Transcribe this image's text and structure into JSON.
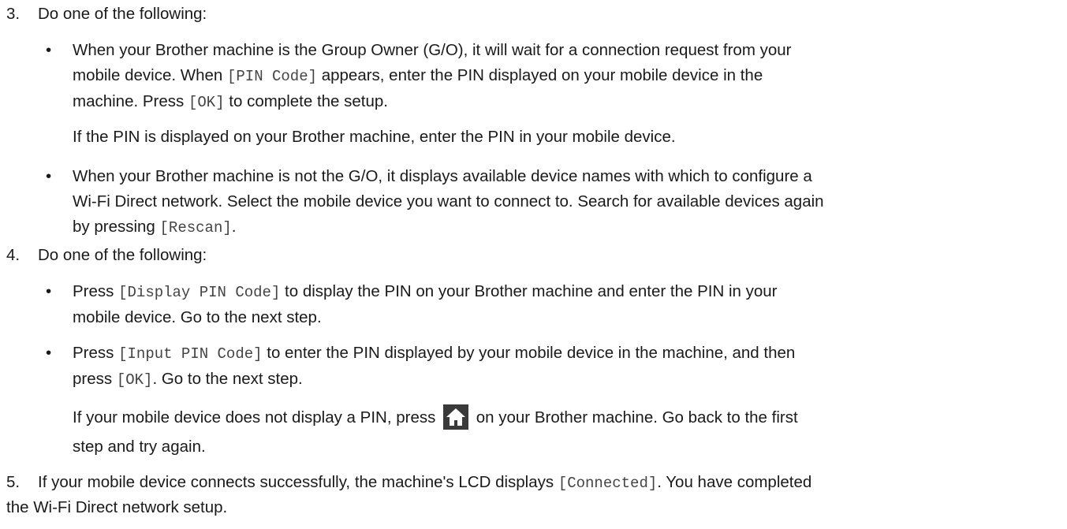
{
  "steps": [
    {
      "num": "3.",
      "head": "Do one of the following:"
    },
    {
      "num": "4.",
      "head": "Do one of the following:"
    },
    {
      "num": "5."
    }
  ],
  "bullet_glyph": "•",
  "s3b1": {
    "l1": "When your Brother machine is the Group Owner (G/O), it will wait for a connection request from your",
    "l2a": "mobile device. When ",
    "l2code": "[PIN Code]",
    "l2b": " appears, enter the PIN displayed on your mobile device in the",
    "l3a": "machine. Press ",
    "l3code": "[OK]",
    "l3b": " to complete the setup.",
    "note": "If the PIN is displayed on your Brother machine, enter the PIN in your mobile device."
  },
  "s3b2": {
    "l1": "When your Brother machine is not the G/O, it displays available device names with which to configure a",
    "l2": "Wi-Fi Direct network. Select the mobile device you want to connect to. Search for available devices again",
    "l3a": "by pressing ",
    "l3code": "[Rescan]",
    "l3b": "."
  },
  "s4b1": {
    "l1a": "Press ",
    "l1code": "[Display PIN Code]",
    "l1b": " to display the PIN on your Brother machine and enter the PIN in your",
    "l2": "mobile device. Go to the next step."
  },
  "s4b2": {
    "l1a": "Press ",
    "l1code": "[Input PIN Code]",
    "l1b": " to enter the PIN displayed by your mobile device in the machine, and then",
    "l2a": "press ",
    "l2code": "[OK]",
    "l2b": ". Go to the next step.",
    "note1a": "If your mobile device does not display a PIN, press ",
    "note1b": " on your Brother machine. Go back to the first",
    "note2": "step and try again."
  },
  "s5": {
    "l1a": "If your mobile device connects successfully, the machine's LCD displays ",
    "l1code": "[Connected]",
    "l1b": ". You have completed",
    "l2": "the Wi-Fi Direct network setup."
  },
  "icons": {
    "home": "home-icon"
  },
  "colors": {
    "home_bg": "#3a3a3a",
    "home_fg": "#ffffff",
    "text": "#1a1a1a",
    "mono": "#444444"
  }
}
